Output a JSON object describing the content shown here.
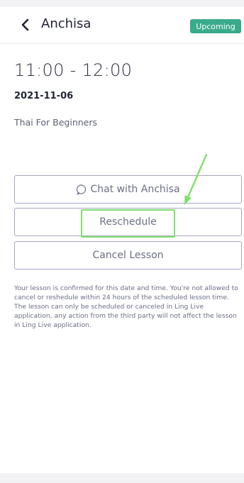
{
  "header": {
    "title": "Anchisa",
    "status": "Upcoming",
    "back_icon": "chevron-left-icon"
  },
  "lesson": {
    "time": "11:00 - 12:00",
    "date": "2021-11-06",
    "course": "Thai For Beginners"
  },
  "actions": {
    "chat_label": "Chat with Anchisa",
    "chat_icon": "chat-bubble-icon",
    "reschedule_label": "Reschedule",
    "cancel_label": "Cancel Lesson"
  },
  "notice": {
    "line1": "Your lesson is confirmed for this date and time. You're not allowed to cancel or reshedule within 24 hours of the scheduled lesson time.",
    "line2": "The lesson can only be scheduled or canceled in Ling Live application, any action from the third party will not affect the lesson in Ling Live application."
  },
  "colors": {
    "badge": "#3aaa8d",
    "highlight": "#7fe06a",
    "button_border": "#a3a8bf",
    "button_text": "#6b6f87"
  }
}
